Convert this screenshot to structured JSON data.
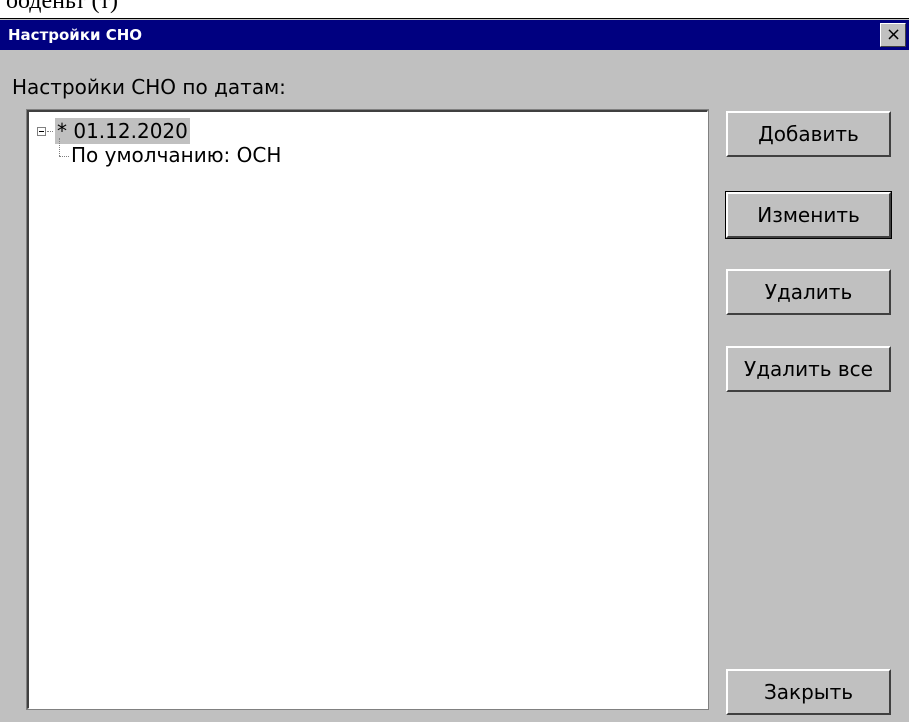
{
  "page_top_text": "ооденьт (т)",
  "window": {
    "title": "Настройки СНО",
    "close_glyph": "×"
  },
  "group_label": "Настройки СНО по датам:",
  "tree": {
    "root_label": "* 01.12.2020",
    "child_label": "По умолчанию: ОСН"
  },
  "buttons": {
    "add": "Добавить",
    "edit": "Изменить",
    "delete": "Удалить",
    "delete_all": "Удалить все",
    "close": "Закрыть"
  },
  "colors": {
    "titlebar": "#000080",
    "dialog_bg": "#c0c0c0",
    "tree_selection": "#c0c0c0"
  }
}
